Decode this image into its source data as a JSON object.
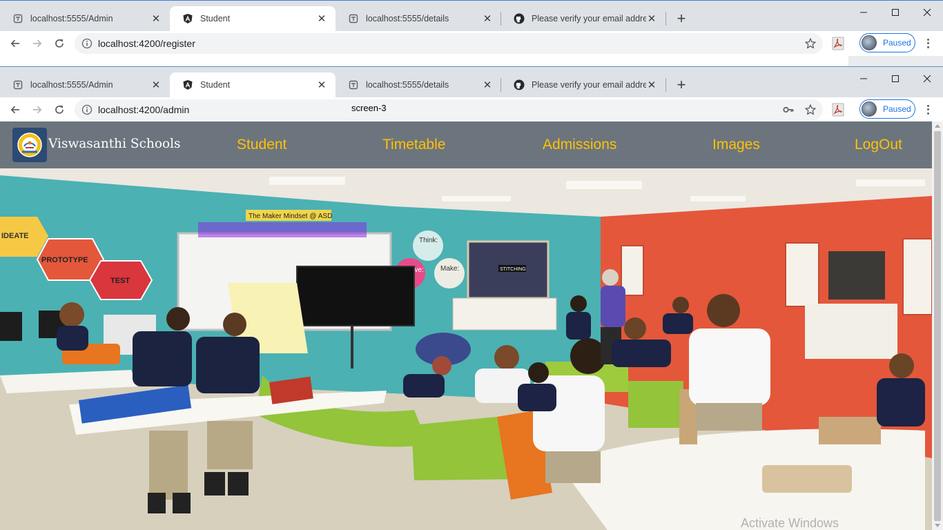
{
  "back_window": {
    "tabs": [
      {
        "title": "localhost:5555/Admin",
        "favicon": "page-icon"
      },
      {
        "title": "Student",
        "favicon": "angular-icon",
        "active": true
      },
      {
        "title": "localhost:5555/details",
        "favicon": "page-icon"
      },
      {
        "title": "Please verify your email address",
        "favicon": "github-icon"
      }
    ],
    "url": "localhost:4200/register",
    "profile_label": "Paused"
  },
  "front_window": {
    "tabs": [
      {
        "title": "localhost:5555/Admin",
        "favicon": "page-icon"
      },
      {
        "title": "Student",
        "favicon": "angular-icon",
        "active": true
      },
      {
        "title": "localhost:5555/details",
        "favicon": "page-icon"
      },
      {
        "title": "Please verify your email address",
        "favicon": "github-icon"
      }
    ],
    "url": "localhost:4200/admin",
    "overlay_label": "screen-3",
    "profile_label": "Paused"
  },
  "site": {
    "brand": "Viswasanthi Schools",
    "nav": [
      "Student",
      "Timetable",
      "Admissions",
      "Images",
      "LogOut"
    ],
    "colors": {
      "navbar": "#6c757d",
      "link": "#ffc107",
      "brand_text": "#ffffff"
    }
  },
  "hero": {
    "signs": [
      "IDEATE",
      "PROTOTYPE",
      "TEST",
      "The Maker Mindset @ ASD",
      "Think:",
      "Make:",
      "Improve:",
      "STITCHING"
    ]
  },
  "watermark": "Activate Windows"
}
